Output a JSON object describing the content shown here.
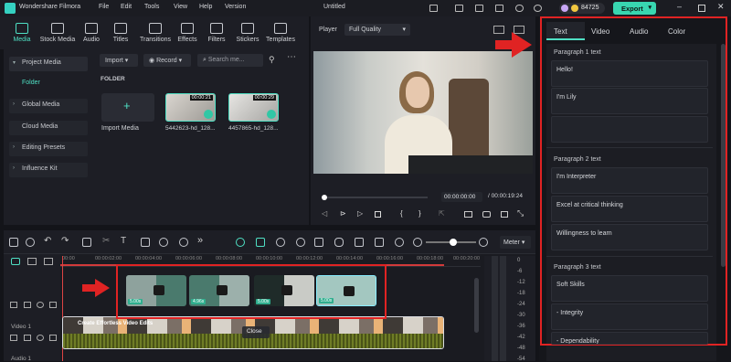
{
  "app": {
    "name": "Wondershare Filmora",
    "menu": [
      "File",
      "Edit",
      "Tools",
      "View",
      "Help",
      "Version"
    ],
    "project_title": "Untitled",
    "credits": "84725",
    "export_label": "Export"
  },
  "toolbar": {
    "items": [
      "Media",
      "Stock Media",
      "Audio",
      "Titles",
      "Transitions",
      "Effects",
      "Filters",
      "Stickers",
      "Templates"
    ]
  },
  "sidebar": {
    "items": [
      "Project Media",
      "Folder",
      "Global Media",
      "Cloud Media",
      "Editing Presets",
      "Influence Kit"
    ]
  },
  "media": {
    "import_label": "Import",
    "record_label": "Record",
    "search_placeholder": "Search me...",
    "folder_label": "FOLDER",
    "import_media_label": "Import Media",
    "clips": [
      {
        "name": "5442623-hd_128...",
        "duration": "00:00:21"
      },
      {
        "name": "4457865-hd_128...",
        "duration": "00:00:29"
      }
    ]
  },
  "player": {
    "label": "Player",
    "quality": "Full Quality",
    "current_time": "00:00:00:00",
    "total_time": "/ 00:00:19:24"
  },
  "timeline": {
    "meter_label": "Meter",
    "ruler": [
      "00:00",
      "00:00:02:00",
      "00:00:04:00",
      "00:00:06:00",
      "00:00:08:00",
      "00:00:10:00",
      "00:00:12:00",
      "00:00:14:00",
      "00:00:16:00",
      "00:00:18:00",
      "00:00:20:00"
    ],
    "meter_scale": [
      "0",
      "-6",
      "-12",
      "-18",
      "-24",
      "-30",
      "-36",
      "-42",
      "-48",
      "-54"
    ],
    "track_labels": [
      "Video 1",
      "Audio 1"
    ],
    "pip_clips": [
      {
        "duration": "5.00s",
        "color": "#2f7f6c"
      },
      {
        "duration": "4.96s",
        "color": "#2f7f6c"
      },
      {
        "duration": "5.00s",
        "color": "#2f7f6c"
      },
      {
        "duration": "5.00s",
        "color": "#2f7f6c"
      }
    ],
    "close_label": "Close",
    "main_clip_text": "Create Effortless Video Edits"
  },
  "panel": {
    "tabs": [
      "Text",
      "Video",
      "Audio",
      "Color"
    ],
    "paragraphs": [
      {
        "title": "Paragraph 1 text",
        "lines": [
          "Hello!",
          "I'm Lily",
          ""
        ]
      },
      {
        "title": "Paragraph 2 text",
        "lines": [
          "I'm Interpreter",
          "Excel at critical thinking",
          "Willingness to learn"
        ]
      },
      {
        "title": "Paragraph 3 text",
        "lines": [
          "Soft Skills",
          "- Integrity",
          "- Dependability"
        ]
      }
    ]
  },
  "colors": {
    "accent": "#4fe0c4",
    "highlight": "#e02323",
    "export": "#38d6b0"
  }
}
